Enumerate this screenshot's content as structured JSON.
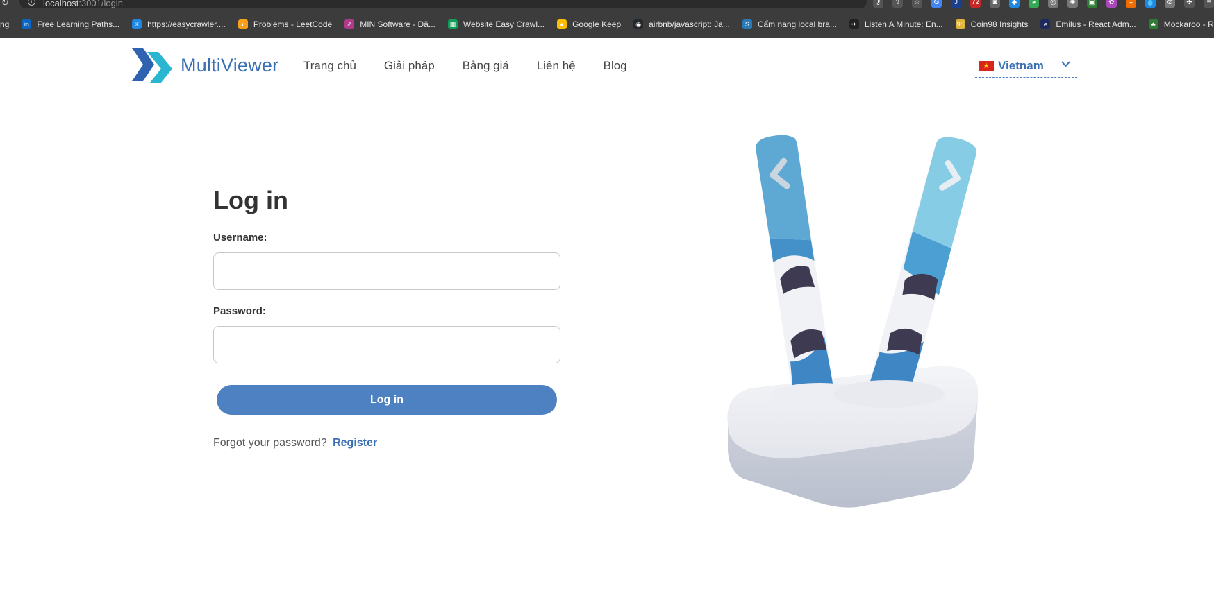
{
  "browser": {
    "url_host": "localhost",
    "url_rest": ":3001/login",
    "extension_badge": "72",
    "bookmarks": [
      {
        "label": "ng",
        "color": "#3c3c3c",
        "glyph": ""
      },
      {
        "label": "Free Learning Paths...",
        "color": "#0a66c2",
        "glyph": "in"
      },
      {
        "label": "https://easycrawler....",
        "color": "#1e88e5",
        "glyph": "✳"
      },
      {
        "label": "Problems - LeetCode",
        "color": "#f89f1b",
        "glyph": "◐"
      },
      {
        "label": "MIN Software - Đă...",
        "color": "#b03a8a",
        "glyph": "⁄⁄"
      },
      {
        "label": "Website Easy Crawl...",
        "color": "#0f9d58",
        "glyph": "▦"
      },
      {
        "label": "Google Keep",
        "color": "#fbbc04",
        "glyph": "●"
      },
      {
        "label": "airbnb/javascript: Ja...",
        "color": "#24292e",
        "glyph": "◉"
      },
      {
        "label": "Cẩm nang local bra...",
        "color": "#2a7ab8",
        "glyph": "S"
      },
      {
        "label": "Listen A Minute: En...",
        "color": "#222222",
        "glyph": "✈"
      },
      {
        "label": "Coin98 Insights",
        "color": "#e2b33c",
        "glyph": "98"
      },
      {
        "label": "Emilus - React Adm...",
        "color": "#1d2a5b",
        "glyph": "e"
      },
      {
        "label": "Mockaroo - Rando",
        "color": "#2e7d32",
        "glyph": "♣"
      }
    ]
  },
  "header": {
    "brand": "MultiViewer",
    "nav": [
      "Trang chủ",
      "Giải pháp",
      "Bảng giá",
      "Liên hệ",
      "Blog"
    ],
    "language": "Vietnam"
  },
  "login": {
    "title": "Log in",
    "username_label": "Username:",
    "username_value": "",
    "password_label": "Password:",
    "password_value": "",
    "submit_label": "Log in",
    "forgot_text": "Forgot your password?",
    "register_label": "Register"
  },
  "colors": {
    "brand_blue": "#3a6fb3",
    "button_blue": "#4e81c1",
    "logo_teal": "#2ab5d1"
  }
}
